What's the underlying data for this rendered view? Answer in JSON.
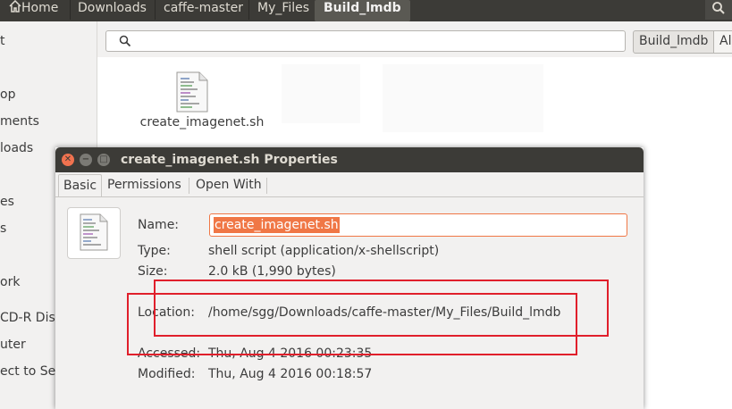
{
  "breadcrumb": {
    "items": [
      "Home",
      "Downloads",
      "caffe-master",
      "My_Files",
      "Build_lmdb"
    ],
    "active_index": 4
  },
  "sidebar": {
    "items": [
      "t",
      "op",
      "ments",
      "loads",
      "es",
      "s",
      "ork",
      "CD-R Disc",
      "uter",
      "ect to Serv"
    ]
  },
  "toolbar": {
    "search_placeholder": "",
    "location_chips": [
      "Build_lmdb",
      "Al"
    ]
  },
  "files": [
    {
      "name": "create_imagenet.sh",
      "icon": "shell-script-icon"
    }
  ],
  "dialog": {
    "title": "create_imagenet.sh Properties",
    "tabs": [
      "Basic",
      "Permissions",
      "Open With"
    ],
    "active_tab": "Basic",
    "fields": {
      "name_label": "Name:",
      "name_value": "create_imagenet.sh",
      "type_label": "Type:",
      "type_value": "shell script (application/x-shellscript)",
      "size_label": "Size:",
      "size_value": "2.0 kB (1,990 bytes)",
      "location_label": "Location:",
      "location_value": "/home/sgg/Downloads/caffe-master/My_Files/Build_lmdb",
      "accessed_label": "Accessed:",
      "accessed_value": "Thu, Aug  4 2016 00:23:35",
      "modified_label": "Modified:",
      "modified_value": "Thu, Aug  4 2016 00:18:57"
    }
  },
  "colors": {
    "accent": "#f07746",
    "annotation": "#e01f2b",
    "titlebar": "#3c3b37"
  }
}
